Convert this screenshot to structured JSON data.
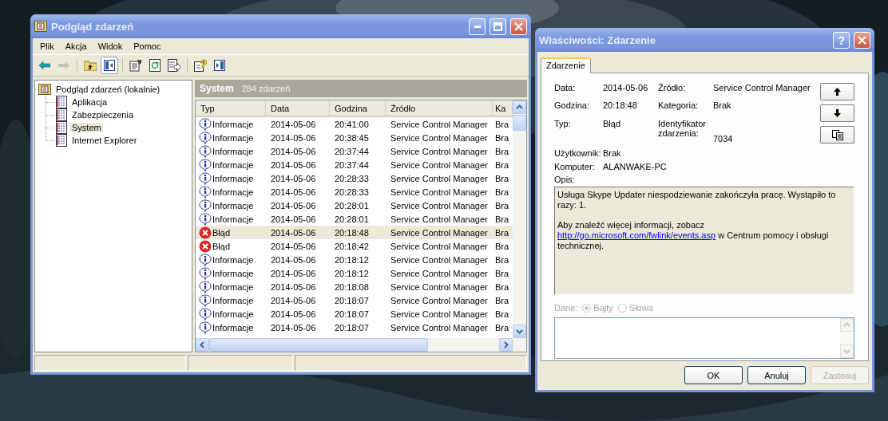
{
  "main_window": {
    "title": "Podgląd zdarzeń",
    "menu": [
      "Plik",
      "Akcja",
      "Widok",
      "Pomoc"
    ],
    "toolbar": [
      [
        {
          "kind": "back",
          "pressed": false,
          "disabled": false
        },
        {
          "kind": "forward",
          "pressed": false,
          "disabled": true
        }
      ],
      [
        {
          "kind": "up",
          "pressed": false,
          "disabled": false
        },
        {
          "kind": "tree",
          "pressed": true,
          "disabled": false
        }
      ],
      [
        {
          "kind": "properties",
          "pressed": false,
          "disabled": false
        },
        {
          "kind": "refresh",
          "pressed": false,
          "disabled": false
        },
        {
          "kind": "export",
          "pressed": false,
          "disabled": false
        }
      ],
      [
        {
          "kind": "help",
          "pressed": false,
          "disabled": false
        },
        {
          "kind": "pane",
          "pressed": false,
          "disabled": false
        }
      ]
    ],
    "tree": {
      "label": "Podgląd zdarzeń (lokalnie)",
      "selected": false,
      "children": [
        {
          "label": "Aplikacja",
          "selected": false
        },
        {
          "label": "Zabezpieczenia",
          "selected": false
        },
        {
          "label": "System",
          "selected": true
        },
        {
          "label": "Internet Explorer",
          "selected": false
        }
      ]
    },
    "pane_header": {
      "title": "System",
      "count": "284 zdarzeń"
    },
    "table": {
      "columns": [
        "Typ",
        "Data",
        "Godzina",
        "Źródło",
        "Ka"
      ],
      "rows": [
        {
          "kind": "info",
          "type": "Informacje",
          "date": "2014-05-06",
          "time": "20:41:00",
          "source": "Service Control Manager",
          "column_5": "Bra",
          "selected": false
        },
        {
          "kind": "info",
          "type": "Informacje",
          "date": "2014-05-06",
          "time": "20:38:45",
          "source": "Service Control Manager",
          "column_5": "Bra",
          "selected": false
        },
        {
          "kind": "info",
          "type": "Informacje",
          "date": "2014-05-06",
          "time": "20:37:44",
          "source": "Service Control Manager",
          "column_5": "Bra",
          "selected": false
        },
        {
          "kind": "info",
          "type": "Informacje",
          "date": "2014-05-06",
          "time": "20:37:44",
          "source": "Service Control Manager",
          "column_5": "Bra",
          "selected": false
        },
        {
          "kind": "info",
          "type": "Informacje",
          "date": "2014-05-06",
          "time": "20:28:33",
          "source": "Service Control Manager",
          "column_5": "Bra",
          "selected": false
        },
        {
          "kind": "info",
          "type": "Informacje",
          "date": "2014-05-06",
          "time": "20:28:33",
          "source": "Service Control Manager",
          "column_5": "Bra",
          "selected": false
        },
        {
          "kind": "info",
          "type": "Informacje",
          "date": "2014-05-06",
          "time": "20:28:01",
          "source": "Service Control Manager",
          "column_5": "Bra",
          "selected": false
        },
        {
          "kind": "info",
          "type": "Informacje",
          "date": "2014-05-06",
          "time": "20:28:01",
          "source": "Service Control Manager",
          "column_5": "Bra",
          "selected": false
        },
        {
          "kind": "error",
          "type": "Błąd",
          "date": "2014-05-06",
          "time": "20:18:48",
          "source": "Service Control Manager",
          "column_5": "Bra",
          "selected": true
        },
        {
          "kind": "error",
          "type": "Błąd",
          "date": "2014-05-06",
          "time": "20:18:42",
          "source": "Service Control Manager",
          "column_5": "Bra",
          "selected": false
        },
        {
          "kind": "info",
          "type": "Informacje",
          "date": "2014-05-06",
          "time": "20:18:12",
          "source": "Service Control Manager",
          "column_5": "Bra",
          "selected": false
        },
        {
          "kind": "info",
          "type": "Informacje",
          "date": "2014-05-06",
          "time": "20:18:12",
          "source": "Service Control Manager",
          "column_5": "Bra",
          "selected": false
        },
        {
          "kind": "info",
          "type": "Informacje",
          "date": "2014-05-06",
          "time": "20:18:08",
          "source": "Service Control Manager",
          "column_5": "Bra",
          "selected": false
        },
        {
          "kind": "info",
          "type": "Informacje",
          "date": "2014-05-06",
          "time": "20:18:07",
          "source": "Service Control Manager",
          "column_5": "Bra",
          "selected": false
        },
        {
          "kind": "info",
          "type": "Informacje",
          "date": "2014-05-06",
          "time": "20:18:07",
          "source": "Service Control Manager",
          "column_5": "Bra",
          "selected": false
        },
        {
          "kind": "info",
          "type": "Informacje",
          "date": "2014-05-06",
          "time": "20:18:07",
          "source": "Service Control Manager",
          "column_5": "Bra",
          "selected": false
        }
      ]
    }
  },
  "dialog": {
    "title": "Właściwości: Zdarzenie",
    "help_button": "?",
    "tabs": [
      {
        "label": "Zdarzenie",
        "selected": true
      }
    ],
    "fields": [
      {
        "label": "Data:",
        "value": "2014-05-06"
      },
      {
        "label": "Źródło:",
        "value": "Service Control Manager"
      },
      {
        "label": "Godzina:",
        "value": "20:18:48"
      },
      {
        "label": "Kategoria:",
        "value": "Brak"
      },
      {
        "label": "Typ:",
        "value": "Błąd"
      },
      {
        "label": "Identyfikator zdarzenia:",
        "value": "7034"
      }
    ],
    "user": {
      "label": "Użytkownik:",
      "value": "Brak"
    },
    "computer": {
      "label": "Komputer:",
      "value": "ALANWAKE-PC"
    },
    "nav_buttons": [
      {
        "kind": "up"
      },
      {
        "kind": "down"
      },
      {
        "kind": "copy"
      }
    ],
    "description_label": "Opis:",
    "description": {
      "paragraph_1": "Usługa Skype Updater niespodziewanie zakończyła pracę. Wystąpiło to razy: 1.",
      "paragraph_2_before": "Aby znaleźć więcej informacji, zobacz",
      "link": "http://go.microsoft.com/fwlink/events.asp",
      "paragraph_2_after": "w Centrum pomocy i obsługi technicznej."
    },
    "data_label": "Dane:",
    "data_disabled": true,
    "data_format": [
      {
        "label": "Bajty",
        "selected": true
      },
      {
        "label": "Słowa",
        "selected": false
      }
    ],
    "buttons": [
      {
        "label": "OK",
        "disabled": false
      },
      {
        "label": "Anuluj",
        "disabled": false
      },
      {
        "label": "Zastosuj",
        "disabled": true
      }
    ]
  }
}
